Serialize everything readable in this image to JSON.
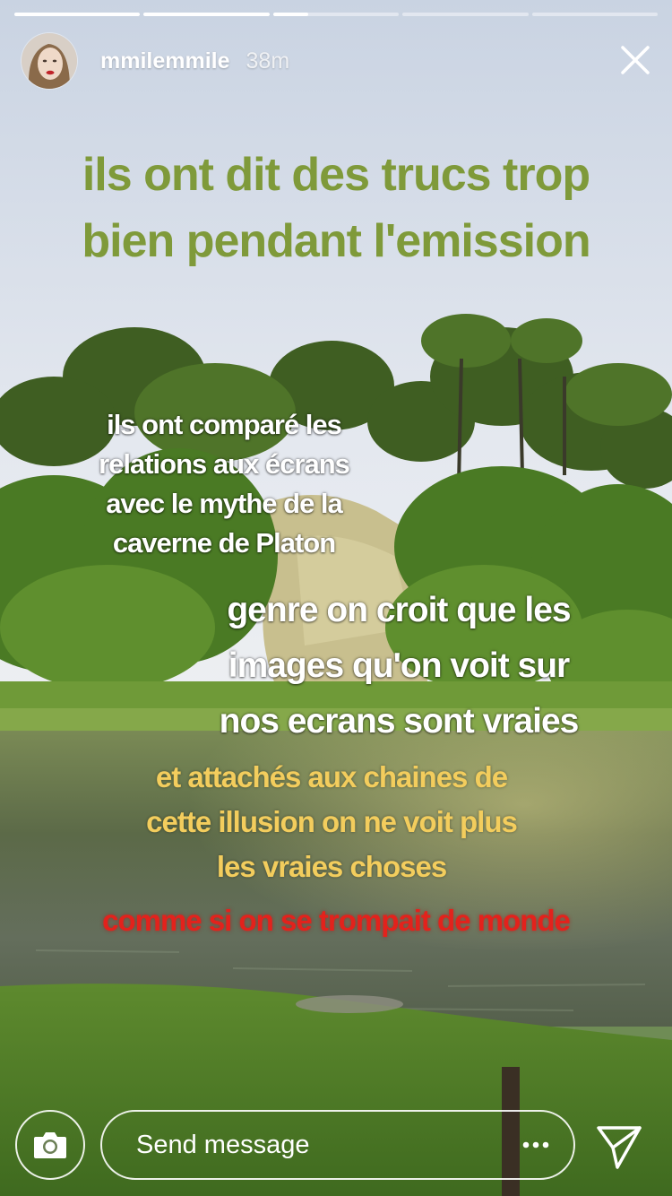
{
  "story": {
    "progress": [
      1,
      1,
      0.28,
      0,
      0
    ],
    "username": "mmilemmile",
    "time_ago": "38m"
  },
  "captions": {
    "title": "ils ont dit des trucs trop\nbien pendant l'emission",
    "block2": "ils ont comparé les\nrelations aux écrans\navec le mythe de la\ncaverne de Platon",
    "block3": "genre on croit que les\nimages qu'on voit sur\nnos ecrans sont vraies",
    "block4": "et attachés aux chaines de\ncette illusion on ne voit plus\nles vraies choses",
    "block5": "comme si on se trompait de monde"
  },
  "colors": {
    "title": "#7f9a3a",
    "white": "#ffffff",
    "yellow": "#f3cd5d",
    "red": "#e3221c"
  },
  "reply": {
    "placeholder": "Send message"
  },
  "icons": {
    "camera": "camera-icon",
    "more": "more-dots-icon",
    "send": "send-paper-plane-icon",
    "close": "close-icon"
  }
}
